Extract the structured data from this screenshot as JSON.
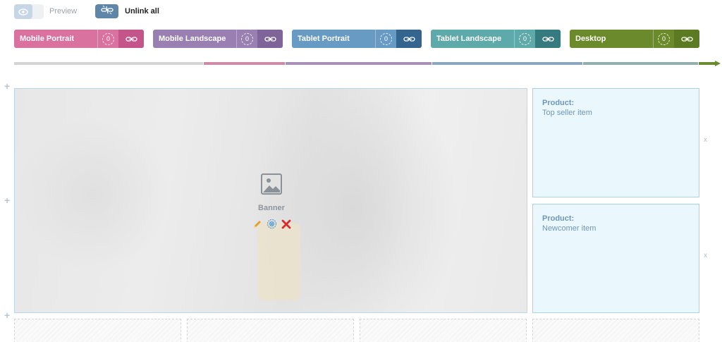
{
  "toolbar": {
    "preview_label": "Preview",
    "preview_icon": "eye-icon",
    "unlink_label": "Unlink all",
    "unlink_icon": "unlink-icon"
  },
  "devices": [
    {
      "name": "Mobile Portrait",
      "count": "0",
      "color": "#d9729f",
      "dark": "#c4558a"
    },
    {
      "name": "Mobile Landscape",
      "count": "0",
      "color": "#9a7fb3",
      "dark": "#7f6499"
    },
    {
      "name": "Tablet Portrait",
      "count": "0",
      "color": "#679bc4",
      "dark": "#33658e"
    },
    {
      "name": "Tablet Landscape",
      "count": "0",
      "color": "#5ea9a9",
      "dark": "#347a7e"
    },
    {
      "name": "Desktop",
      "count": "0",
      "color": "#6b8a2b",
      "dark": "#5b7a22"
    }
  ],
  "rail_colors": [
    "#d4d4d4",
    "#d08aa8",
    "#a890b8",
    "#8aa6c0",
    "#93aeae",
    "#6c8a2f"
  ],
  "banner": {
    "title": "Banner",
    "image_icon": "image-icon",
    "edit_icon": "pencil-icon",
    "settings_icon": "gear-icon",
    "delete_icon": "close-icon"
  },
  "products": [
    {
      "title": "Product:",
      "name": "Top seller item",
      "close": "x"
    },
    {
      "title": "Product:",
      "name": "Newcomer item",
      "close": "x"
    }
  ],
  "add_symbol": "+"
}
